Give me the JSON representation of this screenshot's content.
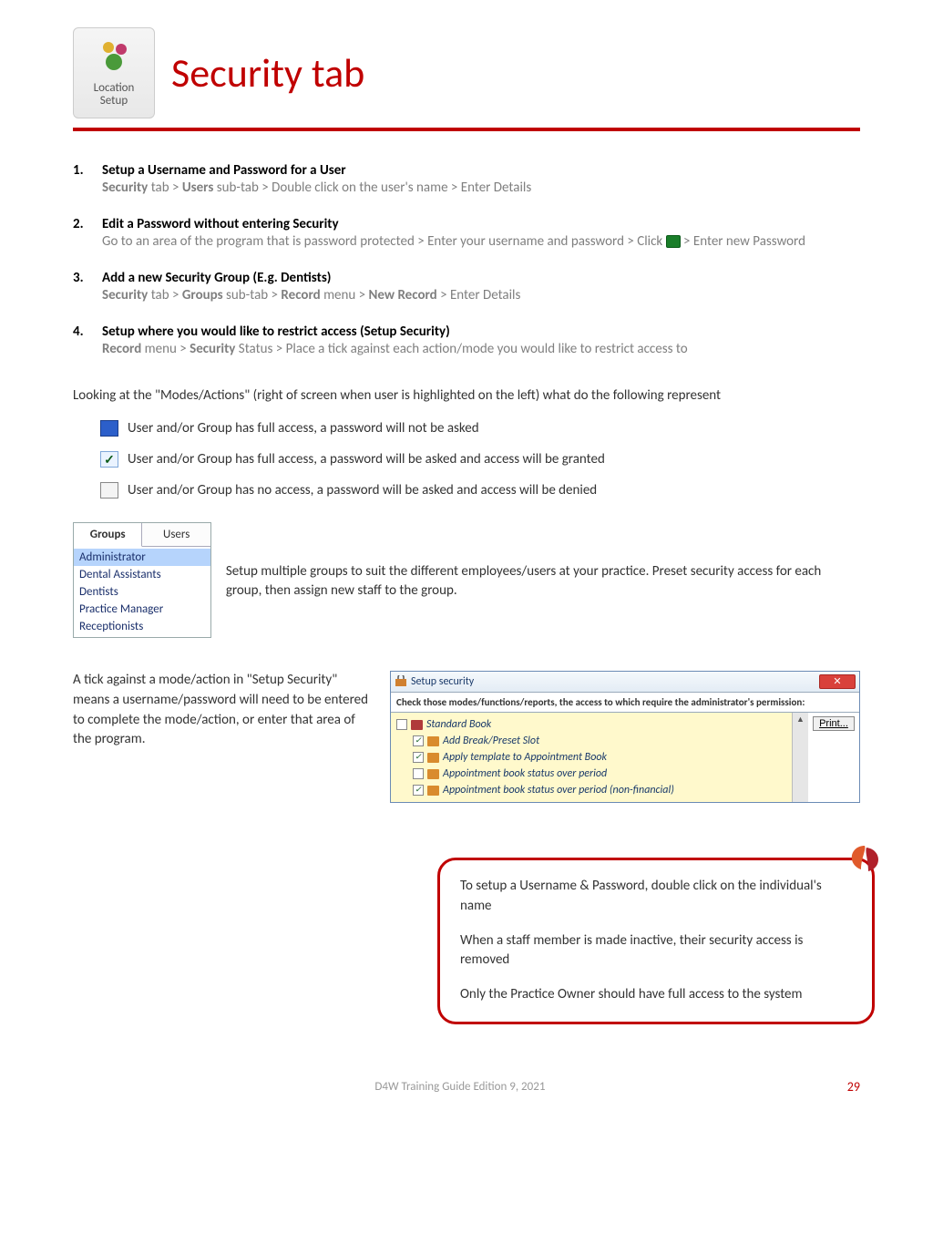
{
  "header": {
    "icon_label_line1": "Location",
    "icon_label_line2": "Setup",
    "title": "Security tab"
  },
  "steps": [
    {
      "num": "1.",
      "title": "Setup a Username and Password for a User",
      "body_parts": [
        "Security",
        " tab > ",
        "Users",
        " sub-tab > Double click on the user's name > Enter Details"
      ]
    },
    {
      "num": "2.",
      "title": "Edit a Password without entering Security",
      "body_prefix": "Go to an area of the program that is password protected > Enter your username and password > Click ",
      "body_suffix": " > Enter new Password"
    },
    {
      "num": "3.",
      "title": "Add a new Security Group (E.g. Dentists)",
      "body_parts": [
        "Security",
        " tab > ",
        "Groups",
        " sub-tab > ",
        "Record",
        " menu > ",
        "New Record",
        " > Enter Details"
      ]
    },
    {
      "num": "4.",
      "title": "Setup where you would like to restrict access (Setup Security)",
      "body_parts": [
        "Record",
        " menu > ",
        "Security",
        " Status > Place a tick against each action/mode you would like to restrict access to"
      ]
    }
  ],
  "intro_q": "Looking at the \"Modes/Actions\" (right of screen when user is highlighted on the left) what do the following represent",
  "legend": [
    "User and/or Group has full access, a password will not be asked",
    "User and/or Group has full access, a password will be asked and access will be granted",
    "User and/or Group has no access, a password will be asked and access will be denied"
  ],
  "tabs": {
    "t1": "Groups",
    "t2": "Users"
  },
  "groups": [
    "Administrator",
    "Dental Assistants",
    "Dentists",
    "Practice Manager",
    "Receptionists"
  ],
  "side_text": "Setup multiple groups to suit the different employees/users at your practice. Preset security access for each group, then assign new staff to the group.",
  "left_text": "A tick against a mode/action in \"Setup Security\" means a username/password will need to be entered to complete the mode/action, or enter that area of the program.",
  "setup_window": {
    "title": "Setup security",
    "subtitle": "Check those modes/functions/reports, the access to which require the administrator's permission:",
    "print": "Print...",
    "tree": [
      {
        "checked": false,
        "label": "Standard Book",
        "root": true
      },
      {
        "checked": true,
        "label": "Add Break/Preset Slot"
      },
      {
        "checked": true,
        "label": "Apply template to Appointment Book"
      },
      {
        "checked": false,
        "label": "Appointment book status over period"
      },
      {
        "checked": true,
        "label": "Appointment book status over period (non-financial)"
      }
    ]
  },
  "callout": {
    "p1": "To setup a Username & Password, double click on the individual's name",
    "p2": "When a staff member is made inactive, their security access is removed",
    "p3": "Only the Practice Owner should have full access to the system"
  },
  "footer": {
    "text": "D4W Training Guide Edition 9, 2021",
    "page": "29"
  }
}
